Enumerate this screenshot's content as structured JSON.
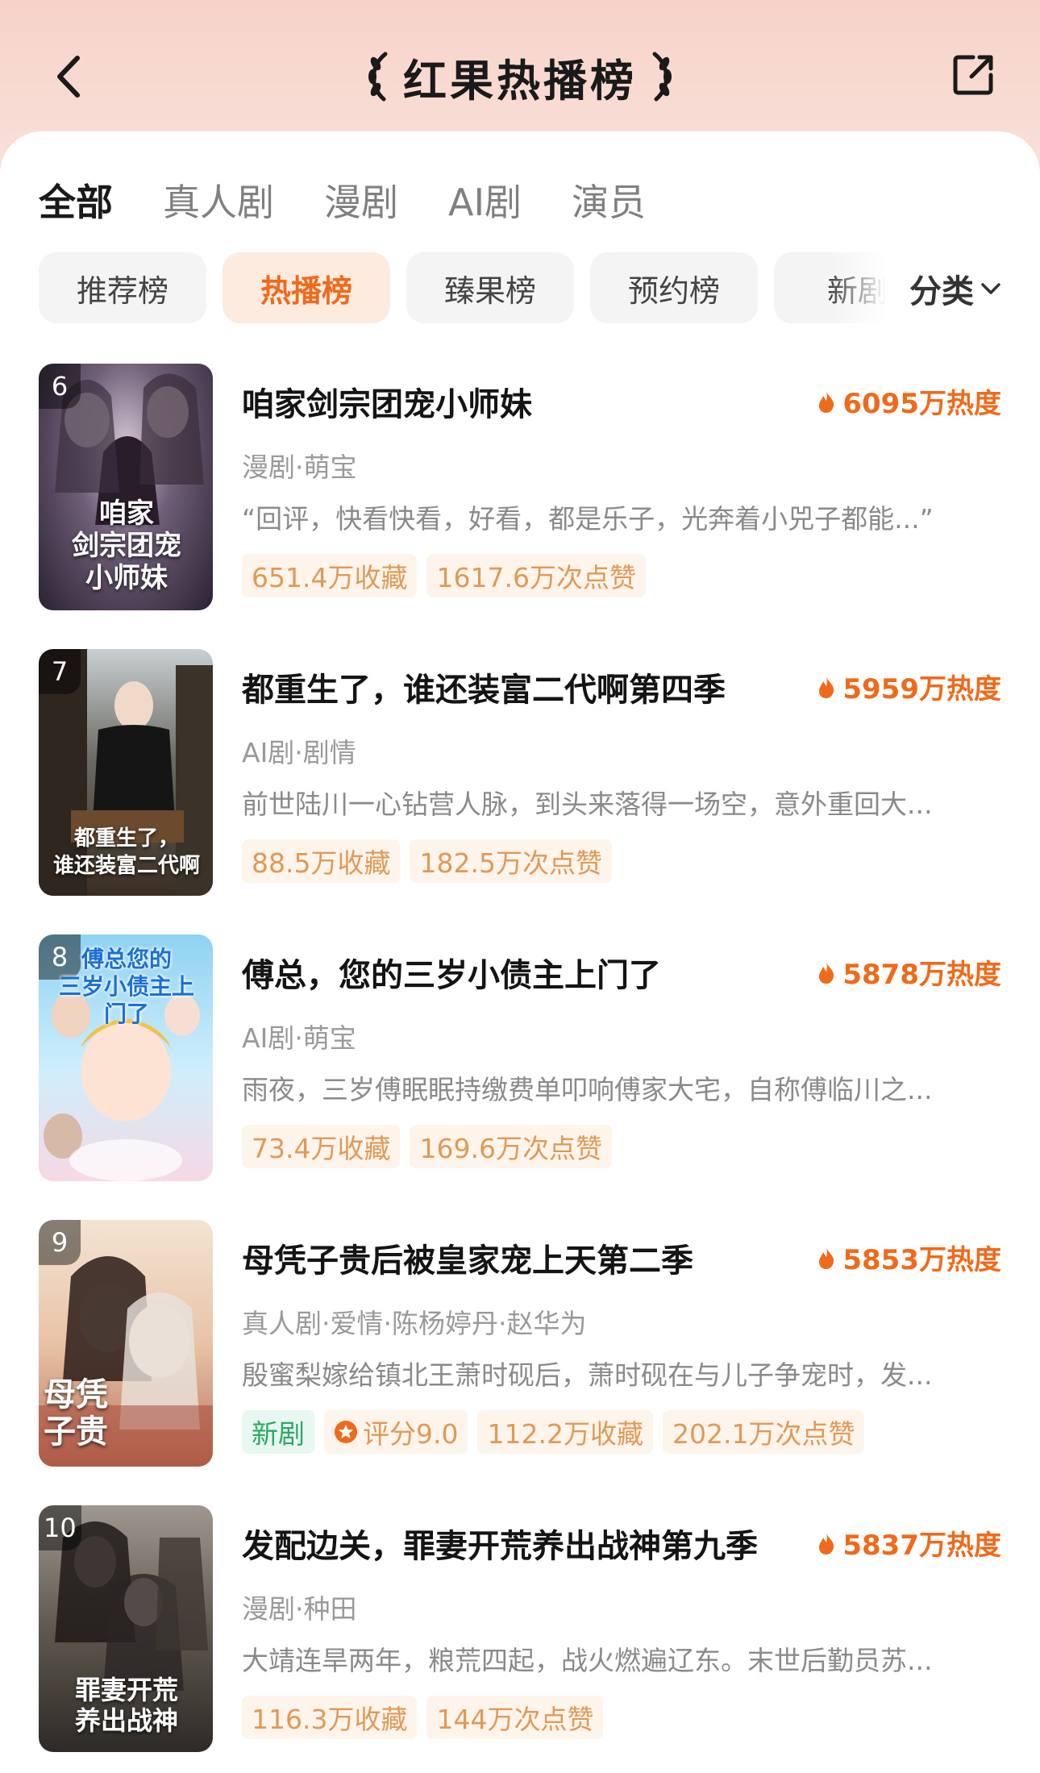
{
  "header": {
    "title": "红果热播榜"
  },
  "tabs": [
    {
      "label": "全部",
      "active": true
    },
    {
      "label": "真人剧",
      "active": false
    },
    {
      "label": "漫剧",
      "active": false
    },
    {
      "label": "AI剧",
      "active": false
    },
    {
      "label": "演员",
      "active": false
    }
  ],
  "chips": [
    {
      "label": "推荐榜",
      "active": false
    },
    {
      "label": "热播榜",
      "active": true
    },
    {
      "label": "臻果榜",
      "active": false
    },
    {
      "label": "预约榜",
      "active": false
    },
    {
      "label": "新剧",
      "active": false
    }
  ],
  "category_label": "分类",
  "colors": {
    "accent": "#ef6a1a",
    "tag_text": "#e09a57",
    "tag_bg": "#fdf4ec",
    "green": "#2fa866"
  },
  "items": [
    {
      "rank": "6",
      "title": "咱家剑宗团宠小师妹",
      "heat": "6095万热度",
      "meta": "漫剧·萌宝",
      "desc": "“回评，快看快看，好看，都是乐子，光奔着小兕子都能...”",
      "cover_text": "咱家\n剑宗团宠\n小师妹",
      "tags": [
        "651.4万收藏",
        "1617.6万次点赞"
      ]
    },
    {
      "rank": "7",
      "title": "都重生了，谁还装富二代啊第四季",
      "heat": "5959万热度",
      "meta": "AI剧·剧情",
      "desc": "前世陆川一心钻营人脉，到头来落得一场空，意外重回大...",
      "cover_text": "都重生了，\n谁还装富二代啊",
      "tags": [
        "88.5万收藏",
        "182.5万次点赞"
      ]
    },
    {
      "rank": "8",
      "title": "傅总，您的三岁小债主上门了",
      "heat": "5878万热度",
      "meta": "AI剧·萌宝",
      "desc": "雨夜，三岁傅眠眠持缴费单叩响傅家大宅，自称傅临川之...",
      "cover_text": "傅总您的\n三岁小债主上门了",
      "tags": [
        "73.4万收藏",
        "169.6万次点赞"
      ]
    },
    {
      "rank": "9",
      "title": "母凭子贵后被皇家宠上天第二季",
      "heat": "5853万热度",
      "meta": "真人剧·爱情·陈杨婷丹·赵华为",
      "desc": "殷蜜梨嫁给镇北王萧时砚后，萧时砚在与儿子争宠时，发...",
      "cover_text": "母凭\n子贵",
      "new_tag": "新剧",
      "rating": "评分9.0",
      "tags": [
        "112.2万收藏",
        "202.1万次点赞"
      ]
    },
    {
      "rank": "10",
      "title": "发配边关，罪妻开荒养出战神第九季",
      "heat": "5837万热度",
      "meta": "漫剧·种田",
      "desc": "大靖连旱两年，粮荒四起，战火燃遍辽东。末世后勤员苏...",
      "cover_text": "罪妻开荒\n养出战神",
      "tags": [
        "116.3万收藏",
        "144万次点赞"
      ]
    }
  ]
}
